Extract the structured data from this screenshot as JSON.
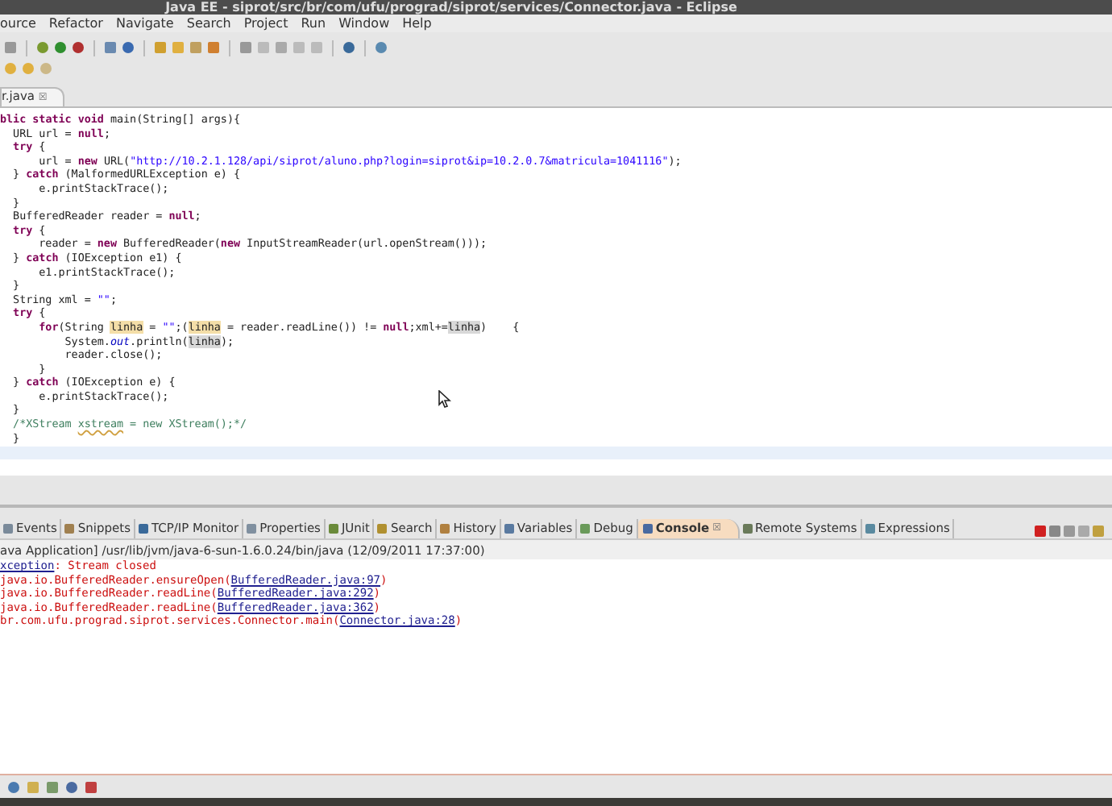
{
  "window": {
    "title": "Java EE - siprot/src/br/com/ufu/prograd/siprot/services/Connector.java - Eclipse"
  },
  "menu": [
    "ource",
    "Refactor",
    "Navigate",
    "Search",
    "Project",
    "Run",
    "Window",
    "Help"
  ],
  "editor": {
    "tab": "r.java",
    "lines": [
      [
        {
          "t": "blic ",
          "kind": "kw"
        },
        {
          "t": "static ",
          "kind": "kw"
        },
        {
          "t": "void ",
          "kind": "kw"
        },
        {
          "t": "main(String[] args){",
          "kind": "p"
        }
      ],
      [
        {
          "t": "  URL url = ",
          "kind": "p"
        },
        {
          "t": "null",
          "kind": "kw"
        },
        {
          "t": ";",
          "kind": "p"
        }
      ],
      [
        {
          "t": "  try",
          "kind": "kw"
        },
        {
          "t": " {",
          "kind": "p"
        }
      ],
      [
        {
          "t": "      url = ",
          "kind": "p"
        },
        {
          "t": "new",
          "kind": "kw"
        },
        {
          "t": " URL(",
          "kind": "p"
        },
        {
          "t": "\"http://10.2.1.128/api/siprot/aluno.php?login=siprot&ip=10.2.0.7&matricula=1041116\"",
          "kind": "str"
        },
        {
          "t": ");",
          "kind": "p"
        }
      ],
      [
        {
          "t": "  } ",
          "kind": "p"
        },
        {
          "t": "catch",
          "kind": "kw"
        },
        {
          "t": " (MalformedURLException e) {",
          "kind": "p"
        }
      ],
      [
        {
          "t": "      e.printStackTrace();",
          "kind": "p"
        }
      ],
      [
        {
          "t": "  }",
          "kind": "p"
        }
      ],
      [
        {
          "t": "  BufferedReader reader = ",
          "kind": "p"
        },
        {
          "t": "null",
          "kind": "kw"
        },
        {
          "t": ";",
          "kind": "p"
        }
      ],
      [
        {
          "t": "  try",
          "kind": "kw"
        },
        {
          "t": " {",
          "kind": "p"
        }
      ],
      [
        {
          "t": "      reader = ",
          "kind": "p"
        },
        {
          "t": "new",
          "kind": "kw"
        },
        {
          "t": " BufferedReader(",
          "kind": "p"
        },
        {
          "t": "new",
          "kind": "kw"
        },
        {
          "t": " InputStreamReader(url.openStream()));",
          "kind": "p"
        }
      ],
      [
        {
          "t": "  } ",
          "kind": "p"
        },
        {
          "t": "catch",
          "kind": "kw"
        },
        {
          "t": " (IOException e1) {",
          "kind": "p"
        }
      ],
      [
        {
          "t": "      e1.printStackTrace();",
          "kind": "p"
        }
      ],
      [
        {
          "t": "  }",
          "kind": "p"
        }
      ],
      [
        {
          "t": "  String xml = ",
          "kind": "p"
        },
        {
          "t": "\"\"",
          "kind": "str"
        },
        {
          "t": ";",
          "kind": "p"
        }
      ],
      [
        {
          "t": "  try",
          "kind": "kw"
        },
        {
          "t": " {",
          "kind": "p"
        }
      ],
      [
        {
          "t": "      for",
          "kind": "kw"
        },
        {
          "t": "(String ",
          "kind": "p"
        },
        {
          "t": "linha",
          "kind": "hl"
        },
        {
          "t": " = ",
          "kind": "p"
        },
        {
          "t": "\"\"",
          "kind": "str"
        },
        {
          "t": ";(",
          "kind": "p"
        },
        {
          "t": "linha",
          "kind": "hl"
        },
        {
          "t": " = reader.readLine()) != ",
          "kind": "p"
        },
        {
          "t": "null",
          "kind": "kw"
        },
        {
          "t": ";xml+=",
          "kind": "p"
        },
        {
          "t": "linha",
          "kind": "hl2"
        },
        {
          "t": ")    {",
          "kind": "p"
        }
      ],
      [
        {
          "t": "          System.",
          "kind": "p"
        },
        {
          "t": "out",
          "kind": "it"
        },
        {
          "t": ".println(",
          "kind": "p"
        },
        {
          "t": "linha",
          "kind": "hl2"
        },
        {
          "t": ");",
          "kind": "p"
        }
      ],
      [
        {
          "t": "          reader.close();",
          "kind": "p"
        }
      ],
      [
        {
          "t": "      }",
          "kind": "p"
        }
      ],
      [
        {
          "t": "  } ",
          "kind": "p"
        },
        {
          "t": "catch",
          "kind": "kw"
        },
        {
          "t": " (IOException e) {",
          "kind": "p"
        }
      ],
      [
        {
          "t": "      e.printStackTrace();",
          "kind": "p"
        }
      ],
      [
        {
          "t": "  }",
          "kind": "p"
        }
      ],
      [
        {
          "t": "  /*XStream ",
          "kind": "cm"
        },
        {
          "t": "xstream",
          "kind": "cmu"
        },
        {
          "t": " = new XStream();*/",
          "kind": "cm"
        }
      ],
      [
        {
          "t": "  }",
          "kind": "p"
        }
      ]
    ]
  },
  "views": {
    "tabs": [
      {
        "label": "Events",
        "selected": false
      },
      {
        "label": "Snippets",
        "selected": false
      },
      {
        "label": "TCP/IP Monitor",
        "selected": false
      },
      {
        "label": "Properties",
        "selected": false
      },
      {
        "label": "JUnit",
        "selected": false
      },
      {
        "label": "Search",
        "selected": false
      },
      {
        "label": "History",
        "selected": false
      },
      {
        "label": "Variables",
        "selected": false
      },
      {
        "label": "Debug",
        "selected": false
      },
      {
        "label": "Console",
        "selected": true
      },
      {
        "label": "Remote Systems",
        "selected": false
      },
      {
        "label": "Expressions",
        "selected": false
      }
    ],
    "close_mark": "☒"
  },
  "console": {
    "header": "ava Application] /usr/lib/jvm/java-6-sun-1.6.0.24/bin/java (12/09/2011 17:37:00)",
    "lines": [
      {
        "link": "xception",
        "suffix": ": Stream closed"
      },
      {
        "prefix": "java.io.BufferedReader.ensureOpen(",
        "link": "BufferedReader.java:97",
        "suffix": ")"
      },
      {
        "prefix": "java.io.BufferedReader.readLine(",
        "link": "BufferedReader.java:292",
        "suffix": ")"
      },
      {
        "prefix": "java.io.BufferedReader.readLine(",
        "link": "BufferedReader.java:362",
        "suffix": ")"
      },
      {
        "prefix": "br.com.ufu.prograd.siprot.services.Connector.main(",
        "link": "Connector.java:28",
        "suffix": ")"
      }
    ]
  }
}
